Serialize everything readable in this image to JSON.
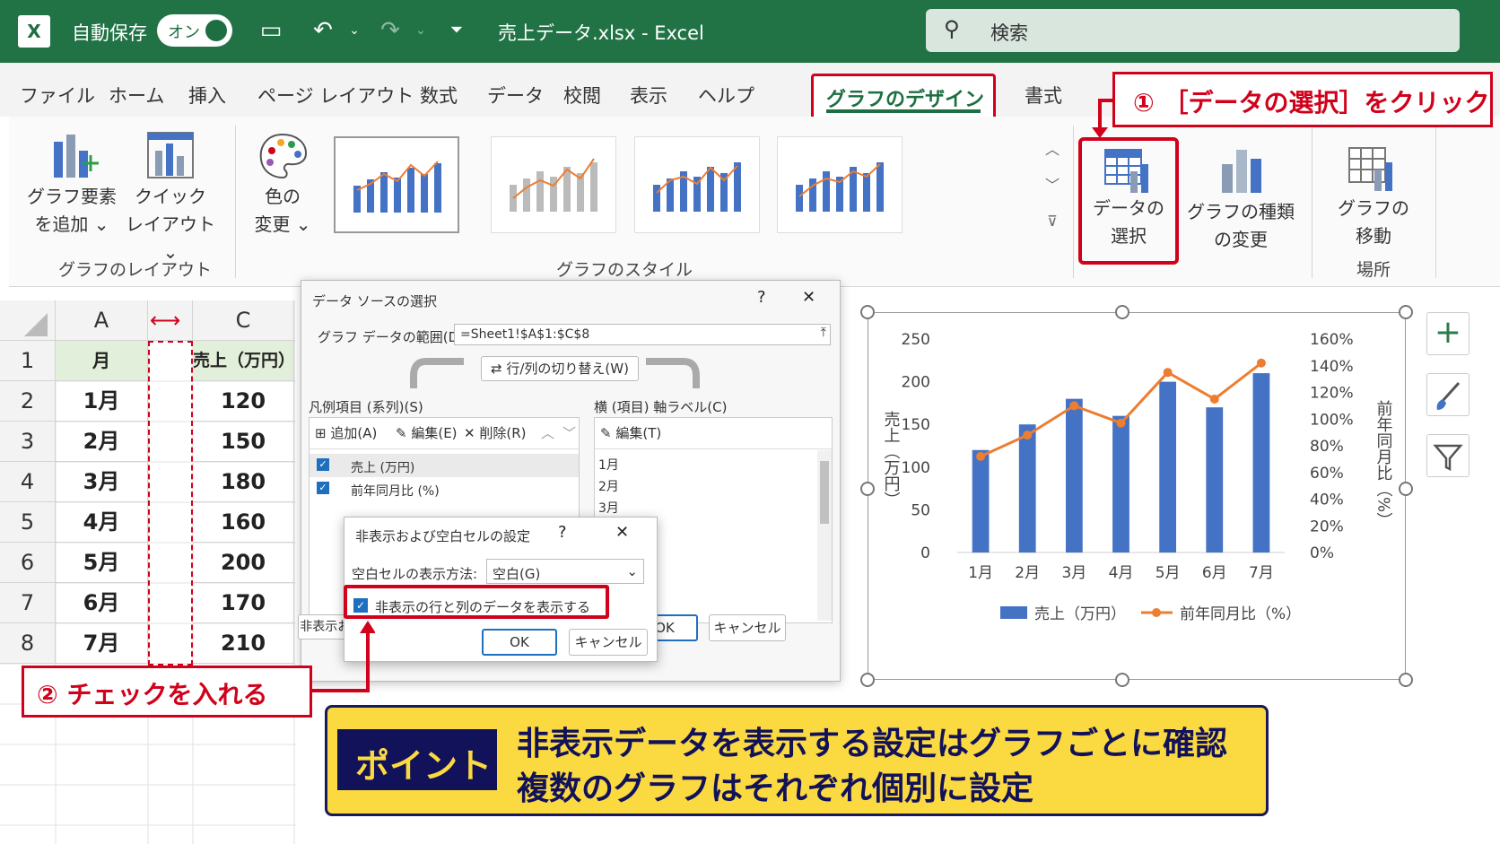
{
  "titlebar": {
    "app_icon": "excel-logo",
    "autosave_label": "自動保存",
    "autosave_toggle": "オン",
    "window_title": "売上データ.xlsx  -  Excel",
    "search_placeholder": "検索"
  },
  "menu": {
    "tabs": [
      "ファイル",
      "ホーム",
      "挿入",
      "ページ レイアウト",
      "数式",
      "データ",
      "校閲",
      "表示",
      "ヘルプ"
    ],
    "active_tab": "グラフのデザイン",
    "format_tab": "書式"
  },
  "ribbon": {
    "add_element": [
      "グラフ要素",
      "を追加 ⌄"
    ],
    "quick_layout": [
      "クイック",
      "レイアウト ⌄"
    ],
    "group_layout": "グラフのレイアウト",
    "change_colors": [
      "色の",
      "変更 ⌄"
    ],
    "group_styles": "グラフのスタイル",
    "select_data": [
      "データの",
      "選択"
    ],
    "change_type": [
      "グラフの種類",
      "の変更"
    ],
    "move_chart": [
      "グラフの",
      "移動"
    ],
    "group_location": "場所"
  },
  "callouts": {
    "step1": "① ［データの選択］をクリック",
    "step2": "② チェックを入れる"
  },
  "sheet": {
    "columns": [
      "A",
      "C"
    ],
    "rows": [
      "1",
      "2",
      "3",
      "4",
      "5",
      "6",
      "7",
      "8"
    ],
    "header": [
      "月",
      "売上（万円）"
    ],
    "data": [
      [
        "1月",
        "120"
      ],
      [
        "2月",
        "150"
      ],
      [
        "3月",
        "180"
      ],
      [
        "4月",
        "160"
      ],
      [
        "5月",
        "200"
      ],
      [
        "6月",
        "170"
      ],
      [
        "7月",
        "210"
      ]
    ]
  },
  "dialog": {
    "title": "データ ソースの選択",
    "help": "?",
    "close": "✕",
    "range_label": "グラフ データの範囲(D):",
    "range_value": "=Sheet1!$A$1:$C$8",
    "switch_button": "行/列の切り替え(W)",
    "legend_label": "凡例項目 (系列)(S)",
    "add": "追加(A)",
    "edit": "編集(E)",
    "delete": "削除(R)",
    "series": [
      "売上 (万円)",
      "前年同月比 (%)"
    ],
    "axis_label": "横 (項目) 軸ラベル(C)",
    "axis_edit": "編集(T)",
    "axis_items": [
      "1月",
      "2月",
      "3月"
    ],
    "hidden_cells_button": "非表示お　び空白セル(H)",
    "ok": "OK",
    "cancel": "キャンセル"
  },
  "subdialog": {
    "title": "非表示および空白セルの設定",
    "help": "?",
    "close": "✕",
    "empty_label": "空白セルの表示方法:",
    "empty_value": "空白(G)",
    "checkbox_label": "非表示の行と列のデータを表示する",
    "ok": "OK",
    "cancel": "キャンセル"
  },
  "chart_data": {
    "type": "bar",
    "categories": [
      "1月",
      "2月",
      "3月",
      "4月",
      "5月",
      "6月",
      "7月"
    ],
    "series": [
      {
        "name": "売上（万円）",
        "type": "bar",
        "axis": "left",
        "values": [
          120,
          150,
          180,
          160,
          200,
          170,
          210
        ],
        "color": "#4472c4"
      },
      {
        "name": "前年同月比（%）",
        "type": "line",
        "axis": "right",
        "values": [
          72,
          88,
          110,
          97,
          135,
          115,
          142
        ],
        "color": "#ed7d31"
      }
    ],
    "ylabel": "売上（万円）",
    "y2label": "前年同月比（%）",
    "ylim": [
      0,
      250
    ],
    "y2lim": [
      0,
      160
    ],
    "yticks": [
      "0",
      "50",
      "100",
      "150",
      "200",
      "250"
    ],
    "y2ticks": [
      "0%",
      "20%",
      "40%",
      "60%",
      "80%",
      "100%",
      "120%",
      "140%",
      "160%"
    ],
    "legend": [
      "売上（万円）",
      "前年同月比（%）"
    ],
    "legend_position": "bottom"
  },
  "point": {
    "badge": "ポイント",
    "line1": "非表示データを表示する設定はグラフごとに確認",
    "line2": "複数のグラフはそれぞれ個別に設定"
  },
  "colors": {
    "excel_green": "#217346",
    "accent_red": "#d0021b",
    "bar_blue": "#4472c4",
    "line_orange": "#ed7d31",
    "point_yellow": "#fbd941",
    "point_navy": "#12125a"
  }
}
